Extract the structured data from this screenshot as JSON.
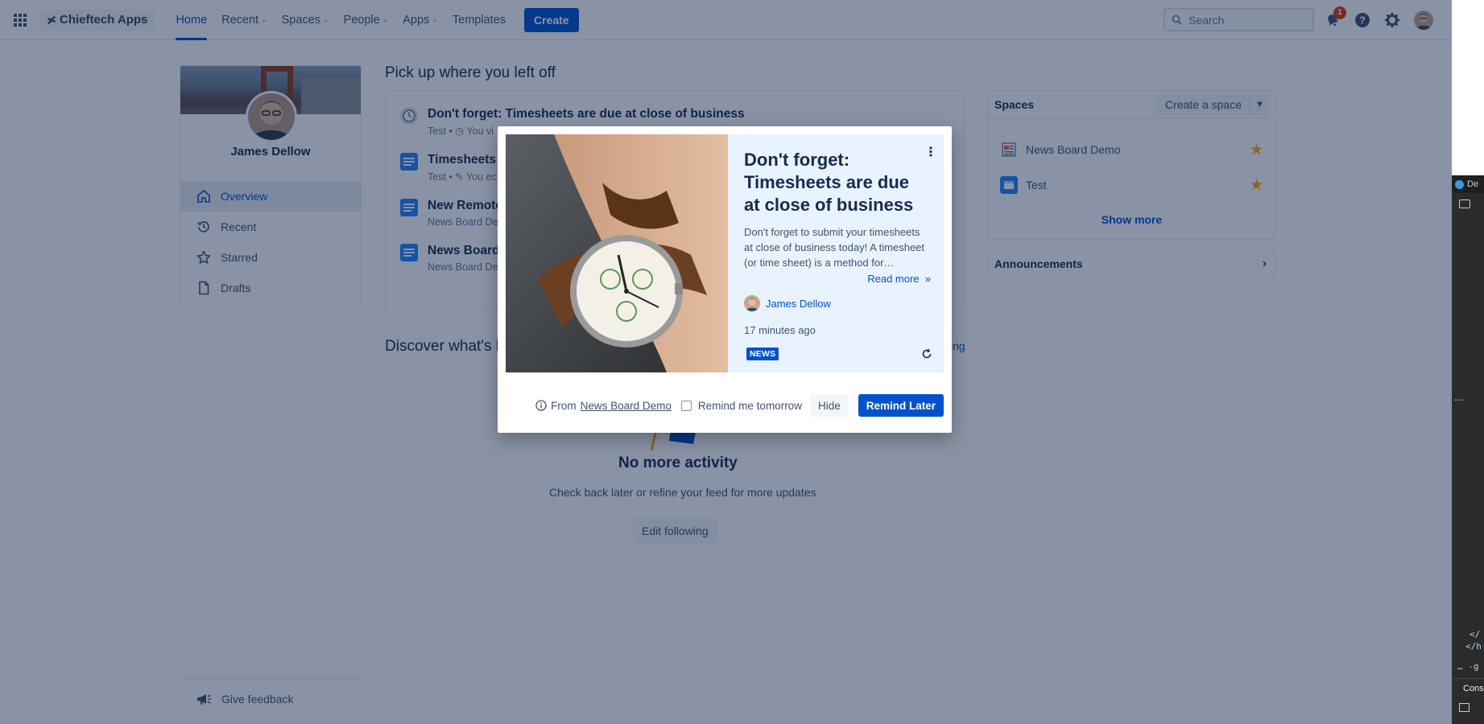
{
  "topnav": {
    "logo": "Chieftech Apps",
    "items": [
      {
        "label": "Home",
        "active": true,
        "dropdown": false
      },
      {
        "label": "Recent",
        "active": false,
        "dropdown": true
      },
      {
        "label": "Spaces",
        "active": false,
        "dropdown": true
      },
      {
        "label": "People",
        "active": false,
        "dropdown": true
      },
      {
        "label": "Apps",
        "active": false,
        "dropdown": true
      },
      {
        "label": "Templates",
        "active": false,
        "dropdown": false
      }
    ],
    "create_label": "Create",
    "search_placeholder": "Search",
    "notification_count": "1"
  },
  "profile": {
    "name": "James Dellow",
    "menu": [
      {
        "label": "Overview",
        "icon": "home-icon",
        "active": true
      },
      {
        "label": "Recent",
        "icon": "history-icon",
        "active": false
      },
      {
        "label": "Starred",
        "icon": "star-icon",
        "active": false
      },
      {
        "label": "Drafts",
        "icon": "page-icon",
        "active": false
      }
    ],
    "feedback_label": "Give feedback"
  },
  "main": {
    "pickup_title": "Pick up where you left off",
    "recent_items": [
      {
        "title": "Don't forget: Timesheets are due at close of business",
        "sub": "Test • ◷ You vi"
      },
      {
        "title": "Timesheets a",
        "sub": "Test • ✎ You ec"
      },
      {
        "title": "New Remote",
        "sub": "News Board Dem"
      },
      {
        "title": "News Board D",
        "sub": "News Board Dem"
      }
    ],
    "discover_title": "Discover what's h",
    "discover_link_fragment": "ing",
    "no_activity": "No more activity",
    "check_back": "Check back later or refine your feed for more updates",
    "edit_following": "Edit following"
  },
  "spaces": {
    "title": "Spaces",
    "create_label": "Create a space",
    "items": [
      {
        "name": "News Board Demo",
        "starred": true
      },
      {
        "name": "Test",
        "starred": true
      }
    ],
    "show_more": "Show more"
  },
  "announcements": {
    "title": "Announcements"
  },
  "devtools": {
    "tab": "De",
    "console": "Cons",
    "lines": [
      "</",
      "</h",
      "… ˗g"
    ]
  },
  "modal": {
    "news_title": "Don't forget: Timesheets are due at close of business",
    "excerpt": "Don't forget to submit your timesheets at close of business today! A timesheet (or time sheet) is a method for…",
    "read_more": "Read more",
    "author": "James Dellow",
    "time_ago": "17 minutes ago",
    "lozenge": "NEWS",
    "from_prefix": "From",
    "from_space": "News Board Demo",
    "remind_tomorrow": "Remind me tomorrow",
    "hide_label": "Hide",
    "remind_later_label": "Remind Later"
  },
  "colors": {
    "brand": "#0052cc",
    "overlay": "rgba(9,30,66,0.48)",
    "card_bg": "#e9f2ff",
    "star": "#ffab00"
  }
}
